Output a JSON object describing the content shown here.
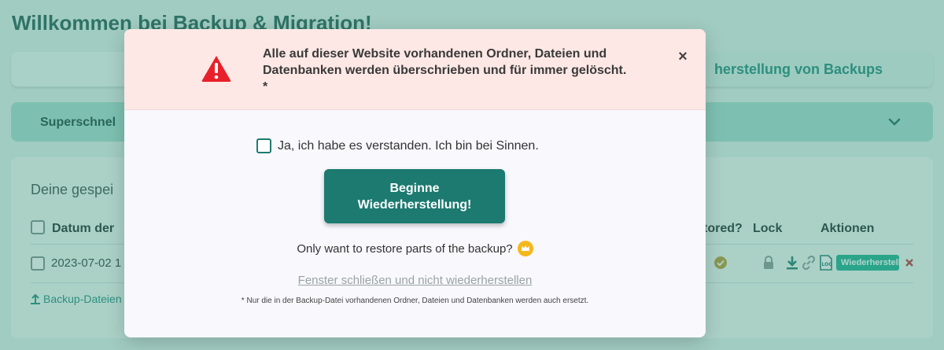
{
  "page": {
    "title": "Willkommen bei Backup & Migration!",
    "tab_restore_label": "herstellung von Backups",
    "accordion_title": "Superschnel",
    "card_title": "Deine gespei",
    "table": {
      "header_date": "Datum der",
      "header_restored": "tored?",
      "header_lock": "Lock",
      "header_actions": "Aktionen",
      "row_date": "2023-07-02 1",
      "row_action_label": "Wiederherstell"
    },
    "upload_link": "Backup-Dateien"
  },
  "modal": {
    "warning_text": "Alle auf dieser Website vorhandenen Ordner, Dateien und Datenbanken werden überschrieben und für immer gelöscht. *",
    "close_symbol": "×",
    "confirm_label": "Ja, ich habe es verstanden. Ich bin bei Sinnen.",
    "confirm_checked": false,
    "begin_button": "Beginne Wiederherstellung!",
    "partial_restore_text": "Only want to restore parts of the backup?",
    "cancel_link": "Fenster schließen und nicht wiederherstellen",
    "footnote": "* Nur die in der Backup-Datei vorhandenen Ordner, Dateien und Datenbanken werden auch ersetzt."
  },
  "colors": {
    "warning_red": "#e8202a",
    "primary_teal": "#1c7a70",
    "crown_gold": "#f5b81c",
    "header_bg": "#fde8e5"
  },
  "icons": [
    "warning-icon",
    "close-icon",
    "crown-icon",
    "chevron-down-icon",
    "upload-icon",
    "check-circle-icon",
    "lock-icon",
    "download-icon",
    "link-icon",
    "log-icon",
    "delete-icon"
  ]
}
